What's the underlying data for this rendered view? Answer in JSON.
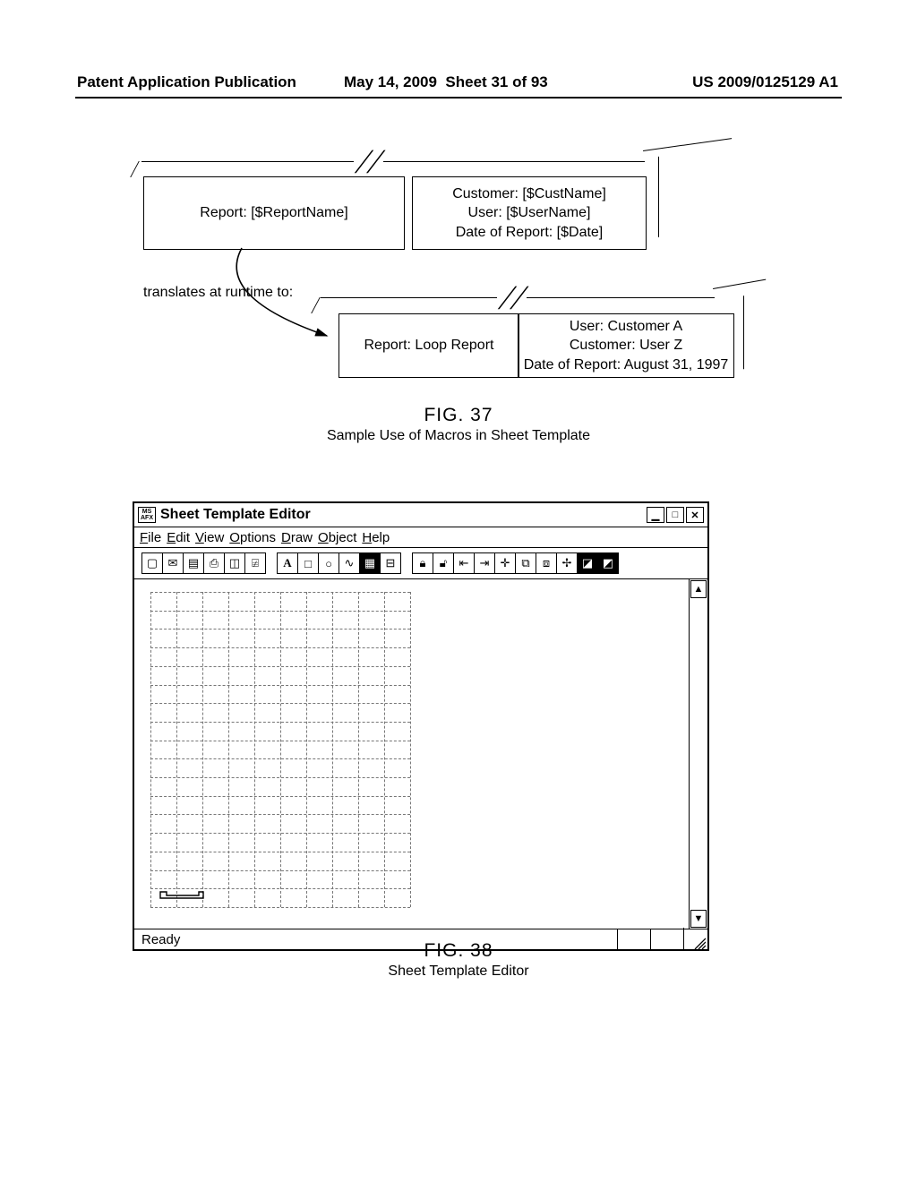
{
  "header": {
    "left": "Patent Application Publication",
    "mid_date": "May 14, 2009",
    "mid_sheet": "Sheet 31 of 93",
    "right": "US 2009/0125129 A1"
  },
  "fig37": {
    "template_left": "Report: [$ReportName]",
    "template_right": "Customer: [$CustName]\nUser: [$UserName]\nDate of Report: [$Date]",
    "translate_label": "translates at runtime to:",
    "runtime_left": "Report: Loop Report",
    "runtime_right": "User: Customer A\nCustomer: User Z\nDate of Report: August 31, 1997",
    "fig_label": "FIG. 37",
    "fig_sub": "Sample Use of Macros in Sheet Template"
  },
  "fig38": {
    "title": "Sheet Template Editor",
    "app_icon_top": "MS",
    "app_icon_bot": "AFX",
    "menu": [
      "File",
      "Edit",
      "View",
      "Options",
      "Draw",
      "Object",
      "Help"
    ],
    "status": "Ready",
    "fig_label": "FIG. 38",
    "fig_sub": "Sheet Template Editor",
    "toolbar_groups": [
      [
        "new",
        "open",
        "save",
        "print",
        "preview",
        "zoom"
      ],
      [
        "text",
        "rect",
        "circle",
        "line",
        "image",
        "ruler"
      ],
      [
        "lock",
        "unlock",
        "align-left",
        "align-right",
        "center",
        "group",
        "ungroup",
        "cross",
        "front",
        "back"
      ]
    ]
  }
}
